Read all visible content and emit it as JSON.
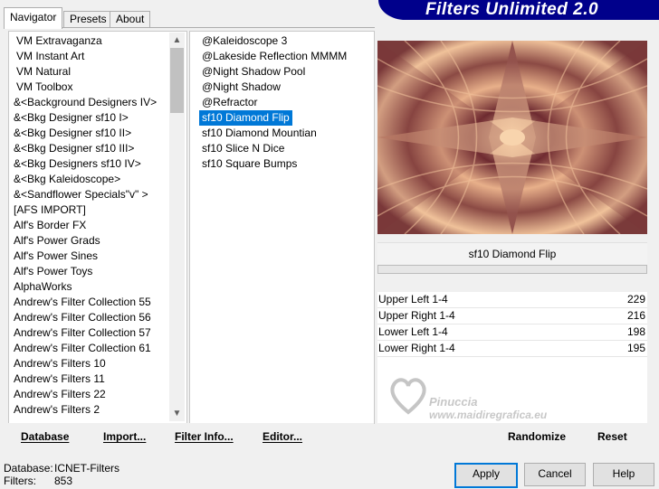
{
  "banner": {
    "title": "Filters Unlimited 2.0"
  },
  "tabs": [
    {
      "label": "Navigator"
    },
    {
      "label": "Presets"
    },
    {
      "label": "About"
    }
  ],
  "categories": [
    "VM Extravaganza",
    "VM Instant Art",
    "VM Natural",
    "VM Toolbox",
    "&<Background Designers IV>",
    "&<Bkg Designer sf10 I>",
    "&<Bkg Designer sf10 II>",
    "&<Bkg Designer sf10 III>",
    "&<Bkg Designers sf10 IV>",
    "&<Bkg Kaleidoscope>",
    "&<Sandflower Specials\"v\" >",
    "[AFS IMPORT]",
    "Alf's Border FX",
    "Alf's Power Grads",
    "Alf's Power Sines",
    "Alf's Power Toys",
    "AlphaWorks",
    "Andrew's Filter Collection 55",
    "Andrew's Filter Collection 56",
    "Andrew's Filter Collection 57",
    "Andrew's Filter Collection 61",
    "Andrew's Filters 10",
    "Andrew's Filters 11",
    "Andrew's Filters 22",
    "Andrew's Filters 2"
  ],
  "filters": [
    "@Kaleidoscope 3",
    "@Lakeside Reflection MMMM",
    "@Night Shadow Pool",
    "@Night Shadow",
    "@Refractor",
    "sf10 Diamond Flip",
    "sf10 Diamond Mountian",
    "sf10 Slice N Dice",
    "sf10 Square Bumps"
  ],
  "selected_filter_index": 5,
  "preview": {
    "caption": "sf10 Diamond Flip"
  },
  "params": [
    {
      "label": "Upper Left 1-4",
      "value": "229"
    },
    {
      "label": "Upper Right 1-4",
      "value": "216"
    },
    {
      "label": "Lower Left 1-4",
      "value": "198"
    },
    {
      "label": "Lower Right 1-4",
      "value": "195"
    }
  ],
  "toolbar": {
    "database": "Database",
    "import": "Import...",
    "filter_info": "Filter Info...",
    "editor": "Editor...",
    "randomize": "Randomize",
    "reset": "Reset"
  },
  "status": {
    "database_label": "Database:",
    "database_value": "ICNET-Filters",
    "filters_label": "Filters:",
    "filters_value": "853"
  },
  "buttons": {
    "apply": "Apply",
    "cancel": "Cancel",
    "help": "Help"
  },
  "watermark": {
    "name": "Pinuccia",
    "url": "www.maidiregrafica.eu"
  },
  "colors": {
    "selection": "#0078d7",
    "banner": "#00008b"
  }
}
